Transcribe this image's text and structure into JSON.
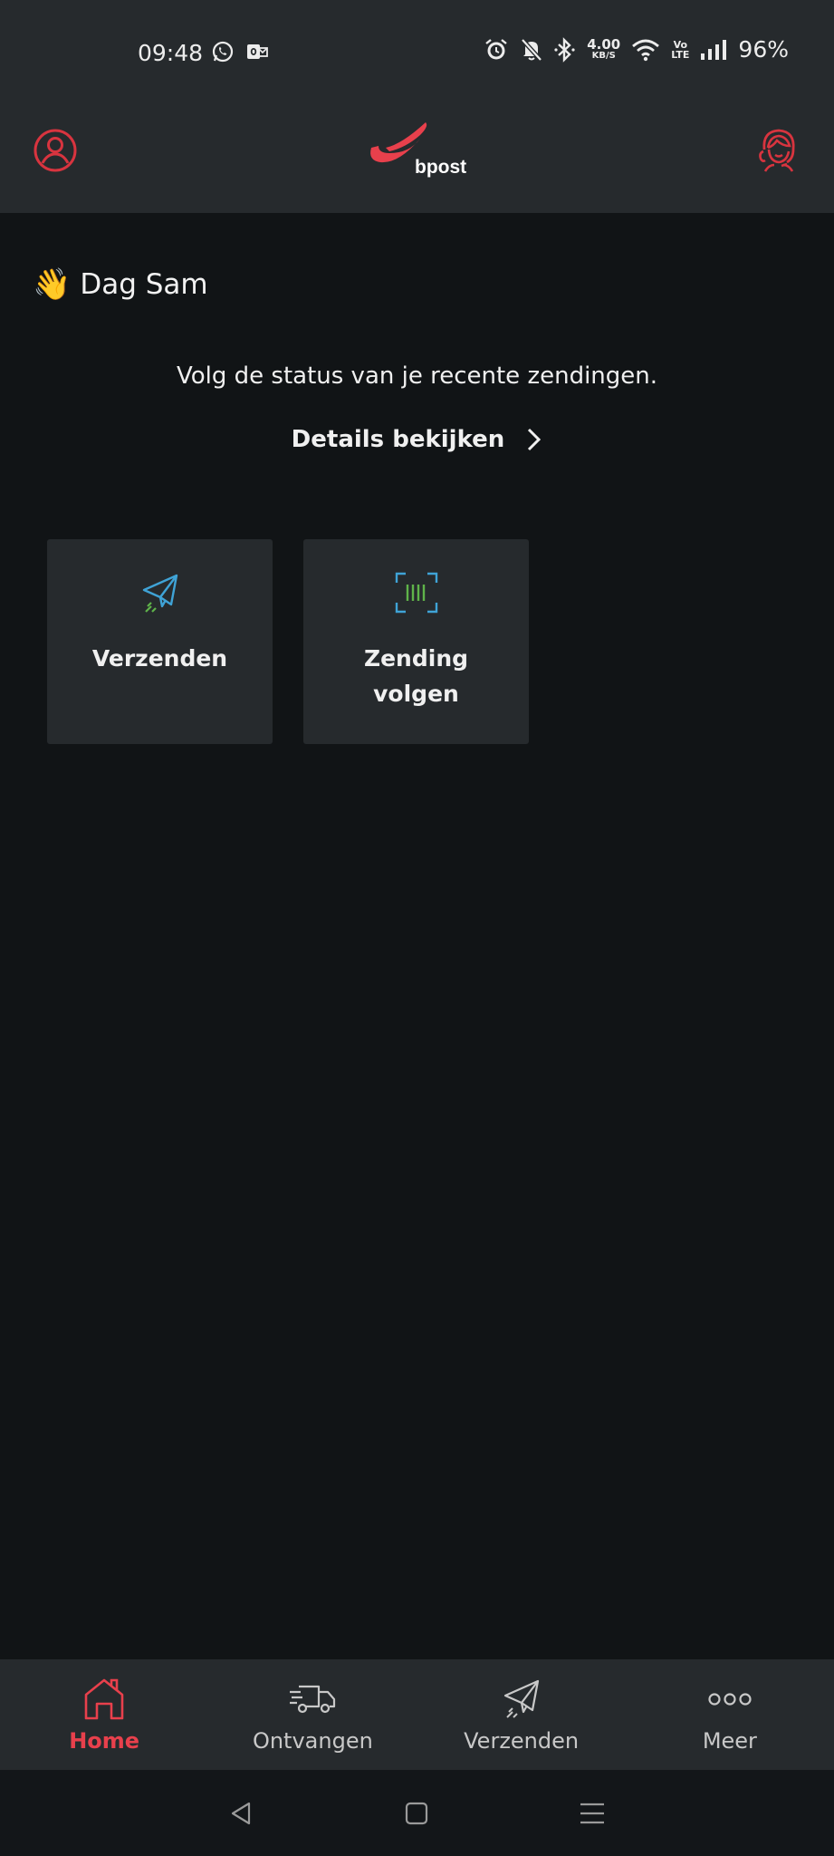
{
  "status_bar": {
    "time": "09:48",
    "net_speed_value": "4.00",
    "net_speed_unit": "KB/S",
    "volte_top": "Vo",
    "volte_bottom": "LTE",
    "battery": "96%"
  },
  "header": {
    "logo_text": "bpost",
    "profile_icon": "user-circle-icon",
    "support_icon": "support-agent-icon"
  },
  "main": {
    "greeting_emoji": "👋",
    "greeting": "Dag Sam",
    "subtitle": "Volg de status van je recente zendingen.",
    "details_link": "Details bekijken",
    "tiles": [
      {
        "label": "Verzenden",
        "icon": "paper-plane-icon"
      },
      {
        "label_line1": "Zending",
        "label_line2": "volgen",
        "icon": "barcode-scan-icon"
      }
    ]
  },
  "bottom_nav": {
    "items": [
      {
        "label": "Home",
        "icon": "home-icon",
        "active": true
      },
      {
        "label": "Ontvangen",
        "icon": "delivery-truck-icon",
        "active": false
      },
      {
        "label": "Verzenden",
        "icon": "paper-plane-icon",
        "active": false
      },
      {
        "label": "Meer",
        "icon": "more-dots-icon",
        "active": false
      }
    ]
  },
  "colors": {
    "accent": "#e8404c",
    "background": "#111416",
    "surface": "#262a2d",
    "icon_blue": "#3fa3d6",
    "icon_green": "#5fb34a"
  }
}
